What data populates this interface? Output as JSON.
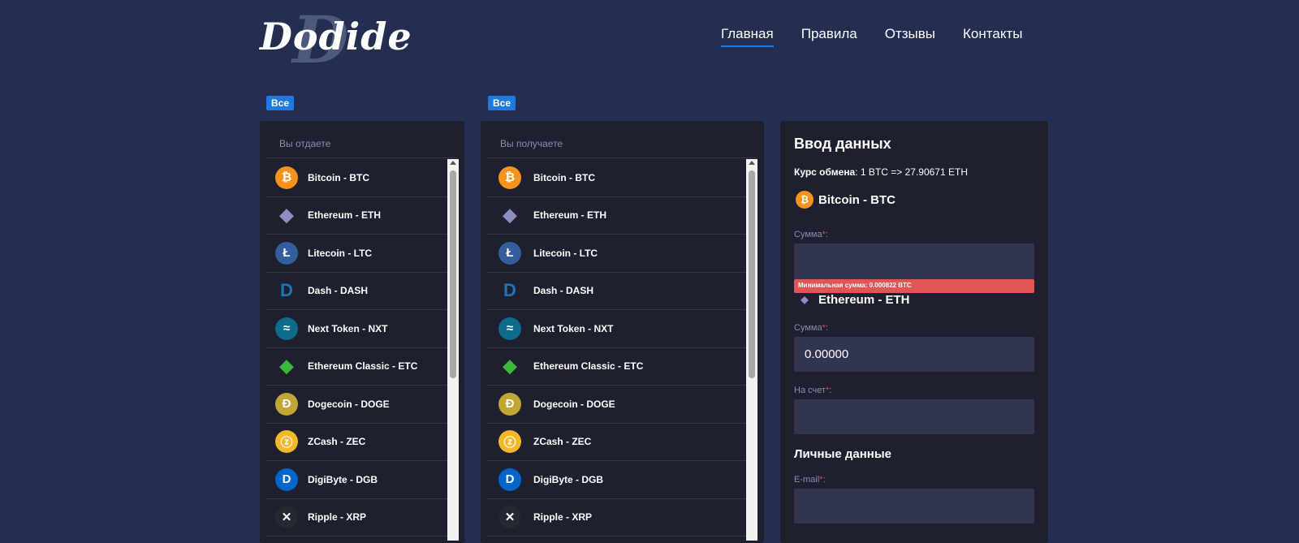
{
  "logo": "Dodide",
  "nav": [
    "Главная",
    "Правила",
    "Отзывы",
    "Контакты"
  ],
  "filter_label": "Все",
  "give": {
    "title": "Вы отдаете"
  },
  "get": {
    "title": "Вы получаете"
  },
  "coins": [
    {
      "name": "Bitcoin - BTC",
      "color": "#f7931a",
      "sym": "₿"
    },
    {
      "name": "Ethereum - ETH",
      "color": "#1e2030",
      "sym": "◆"
    },
    {
      "name": "Litecoin - LTC",
      "color": "#345d9d",
      "sym": "Ł"
    },
    {
      "name": "Dash - DASH",
      "color": "#1e2030",
      "sym": "D"
    },
    {
      "name": "Next Token - NXT",
      "color": "#0d6b8c",
      "sym": "≈"
    },
    {
      "name": "Ethereum Classic - ETC",
      "color": "#1e2030",
      "sym": "◆"
    },
    {
      "name": "Dogecoin - DOGE",
      "color": "#c2a633",
      "sym": "Ð"
    },
    {
      "name": "ZCash - ZEC",
      "color": "#f4b728",
      "sym": "ⓩ"
    },
    {
      "name": "DigiByte - DGB",
      "color": "#0066cc",
      "sym": "D"
    },
    {
      "name": "Ripple - XRP",
      "color": "#23292f",
      "sym": "✕"
    }
  ],
  "form": {
    "title": "Ввод данных",
    "rate_label": "Курс обмена",
    "rate_value": ": 1 BTC => 27.90671 ETH",
    "from_currency": "Bitcoin - BTC",
    "amount_label": "Сумма",
    "amount_from": "",
    "min_error": "Минимальная сумма: 0.000822 BTC",
    "to_currency": "Ethereum - ETH",
    "amount_to": "0.00000",
    "account_label": "На счет",
    "account_value": "",
    "personal_title": "Личные данные",
    "email_label": "E-mail",
    "email_value": "",
    "required_mark": "*",
    "colon": ":"
  }
}
